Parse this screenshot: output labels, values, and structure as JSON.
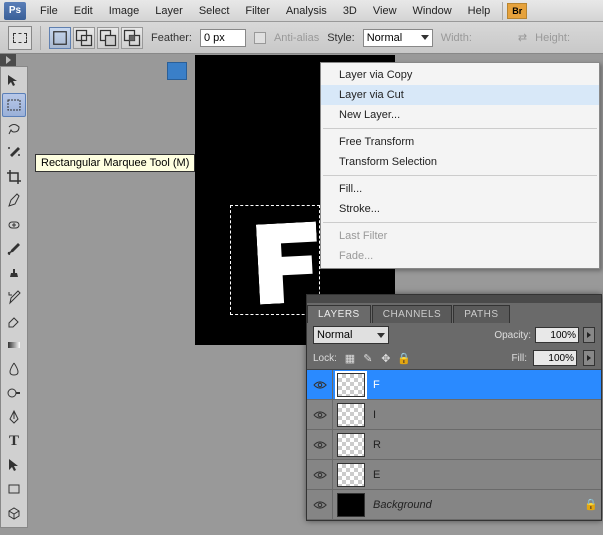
{
  "app": {
    "logo": "Ps",
    "br": "Br"
  },
  "menu": [
    "File",
    "Edit",
    "Image",
    "Layer",
    "Select",
    "Filter",
    "Analysis",
    "3D",
    "View",
    "Window",
    "Help"
  ],
  "options": {
    "feather_label": "Feather:",
    "feather_value": "0 px",
    "antialias": "Anti-alias",
    "style_label": "Style:",
    "style_value": "Normal",
    "width_label": "Width:",
    "height_label": "Height:"
  },
  "tooltip": "Rectangular Marquee Tool (M)",
  "context_menu": {
    "items": [
      {
        "label": "Layer via Copy",
        "dim": false
      },
      {
        "label": "Layer via Cut",
        "dim": false,
        "hl": true
      },
      {
        "label": "New Layer...",
        "dim": false
      },
      {
        "sep": true
      },
      {
        "label": "Free Transform",
        "dim": false
      },
      {
        "label": "Transform Selection",
        "dim": false
      },
      {
        "sep": true
      },
      {
        "label": "Fill...",
        "dim": false
      },
      {
        "label": "Stroke...",
        "dim": false
      },
      {
        "sep": true
      },
      {
        "label": "Last Filter",
        "dim": true
      },
      {
        "label": "Fade...",
        "dim": true
      }
    ]
  },
  "layers_panel": {
    "tabs": [
      "LAYERS",
      "CHANNELS",
      "PATHS"
    ],
    "blend": "Normal",
    "opacity_label": "Opacity:",
    "opacity_value": "100%",
    "lock_label": "Lock:",
    "fill_label": "Fill:",
    "fill_value": "100%",
    "layers": [
      {
        "name": "F",
        "selected": true,
        "thumb": "checker"
      },
      {
        "name": "I",
        "selected": false,
        "thumb": "checker"
      },
      {
        "name": "R",
        "selected": false,
        "thumb": "checker"
      },
      {
        "name": "E",
        "selected": false,
        "thumb": "checker"
      },
      {
        "name": "Background",
        "selected": false,
        "thumb": "black",
        "italic": true,
        "locked": true
      }
    ]
  }
}
